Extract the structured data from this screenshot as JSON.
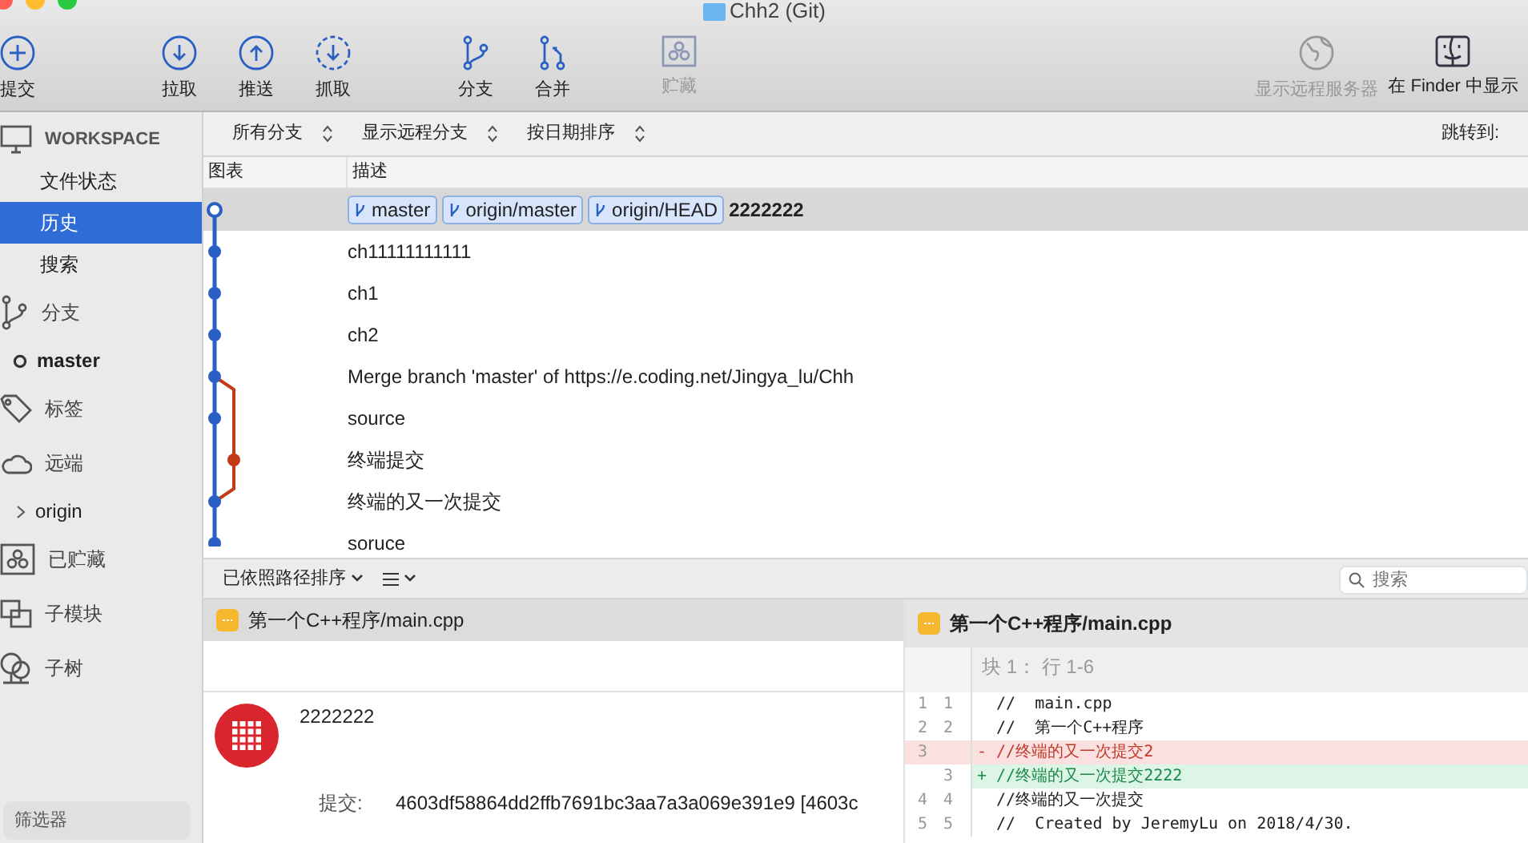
{
  "window": {
    "title": "Chh2 (Git)"
  },
  "toolbar": {
    "left": [
      {
        "label": "提交",
        "disabled": false
      },
      {
        "label": "拉取",
        "disabled": false
      },
      {
        "label": "推送",
        "disabled": false
      },
      {
        "label": "抓取",
        "disabled": false
      },
      {
        "label": "分支",
        "disabled": false
      },
      {
        "label": "合并",
        "disabled": false
      },
      {
        "label": "贮藏",
        "disabled": true
      }
    ],
    "right": [
      {
        "label": "显示远程服务器",
        "disabled": true
      },
      {
        "label": "在 Finder 中显示",
        "disabled": false
      }
    ]
  },
  "sidebar": {
    "items": [
      {
        "kind": "header",
        "label": "WORKSPACE"
      },
      {
        "kind": "item",
        "label": "文件状态",
        "selected": false
      },
      {
        "kind": "item",
        "label": "历史",
        "selected": true
      },
      {
        "kind": "item",
        "label": "搜索",
        "selected": false
      },
      {
        "kind": "section",
        "label": "分支"
      },
      {
        "kind": "branch",
        "label": "master"
      },
      {
        "kind": "section",
        "label": "标签"
      },
      {
        "kind": "section",
        "label": "远端"
      },
      {
        "kind": "remote",
        "label": "origin"
      },
      {
        "kind": "section",
        "label": "已贮藏"
      },
      {
        "kind": "section",
        "label": "子模块"
      },
      {
        "kind": "section",
        "label": "子树"
      }
    ],
    "filter": {
      "placeholder": "筛选器"
    }
  },
  "filters": [
    "所有分支",
    "显示远程分支",
    "按日期排序"
  ],
  "jump_to": "跳转到:",
  "history": {
    "columns": [
      "图表",
      "描述"
    ],
    "rows": [
      {
        "refs": [
          "master",
          "origin/master",
          "origin/HEAD"
        ],
        "message": "2222222",
        "kind": "main",
        "head": true,
        "selected": true
      },
      {
        "refs": [],
        "message": "ch11111111111",
        "kind": "main",
        "head": false,
        "selected": false
      },
      {
        "refs": [],
        "message": "ch1",
        "kind": "main",
        "head": false,
        "selected": false
      },
      {
        "refs": [],
        "message": "ch2",
        "kind": "main",
        "head": false,
        "selected": false
      },
      {
        "refs": [],
        "message": "Merge branch 'master' of https://e.coding.net/Jingya_lu/Chh",
        "kind": "main",
        "head": false,
        "selected": false
      },
      {
        "refs": [],
        "message": "source",
        "kind": "main",
        "head": false,
        "selected": false
      },
      {
        "refs": [],
        "message": "终端提交",
        "kind": "side",
        "head": false,
        "selected": false
      },
      {
        "refs": [],
        "message": "终端的又一次提交",
        "kind": "main",
        "head": false,
        "selected": false
      },
      {
        "refs": [],
        "message": "soruce",
        "kind": "main",
        "head": false,
        "selected": false
      }
    ]
  },
  "files_bar": {
    "sort": "已依照路径排序",
    "search": {
      "placeholder": "搜索"
    }
  },
  "files": [
    {
      "path": "第一个C++程序/main.cpp",
      "selected": true
    }
  ],
  "commit": {
    "message": "2222222",
    "fields": [
      {
        "label": "提交:",
        "value": "4603df58864dd2ffb7691bc3aa7a3a069e391e9 [4603c"
      }
    ]
  },
  "diff": {
    "file": "第一个C++程序/main.cpp",
    "hunk": "块 1： 行 1-6",
    "lines": [
      {
        "old": "1",
        "new": "1",
        "kind": "context",
        "text": "  //  main.cpp"
      },
      {
        "old": "2",
        "new": "2",
        "kind": "context",
        "text": "  //  第一个C++程序"
      },
      {
        "old": "3",
        "kind": "del",
        "text": "- //终端的又一次提交2"
      },
      {
        "new": "3",
        "kind": "add",
        "text": "+ //终端的又一次提交2222"
      },
      {
        "old": "4",
        "new": "4",
        "kind": "context",
        "text": "  //终端的又一次提交"
      },
      {
        "old": "5",
        "new": "5",
        "kind": "context",
        "text": "  //  Created by JeremyLu on 2018/4/30."
      }
    ]
  }
}
